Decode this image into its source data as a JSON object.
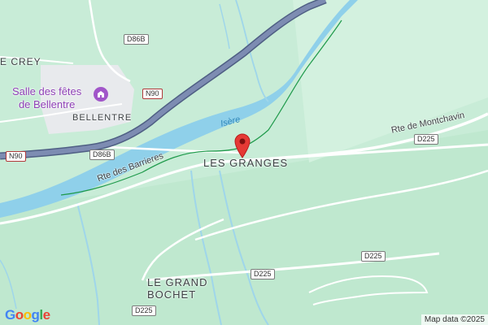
{
  "map": {
    "places": {
      "le_crey": "E CREY",
      "bellentre": "BELLENTRE",
      "les_granges": "LES GRANGES",
      "le_grand_bochet_line1": "LE GRAND",
      "le_grand_bochet_line2": "BOCHET"
    },
    "poi": {
      "line1": "Salle des fêtes",
      "line2": "de Bellentre",
      "icon": "building-icon"
    },
    "roads": {
      "rte_des_barrieres": "Rte des Barrieres",
      "rte_de_montchavin": "Rte de Montchavin"
    },
    "shields": {
      "d86b_top": "D86B",
      "d86b_mid": "D86B",
      "n90_top": "N90",
      "n90_left": "N90",
      "d225_right_top": "D225",
      "d225_right_mid": "D225",
      "d225_center": "D225",
      "d225_bottom": "D225"
    },
    "water": {
      "river": "Isère"
    },
    "marker": {
      "icon": "map-pin-icon",
      "color": "#e53935"
    },
    "colors": {
      "land": "#c9ecd8",
      "river": "#8fd0ea",
      "motorway": "#6b7aa1",
      "town": "#e8eaed"
    }
  },
  "footer": {
    "logo": "Google",
    "attribution": "Map data ©2025"
  }
}
